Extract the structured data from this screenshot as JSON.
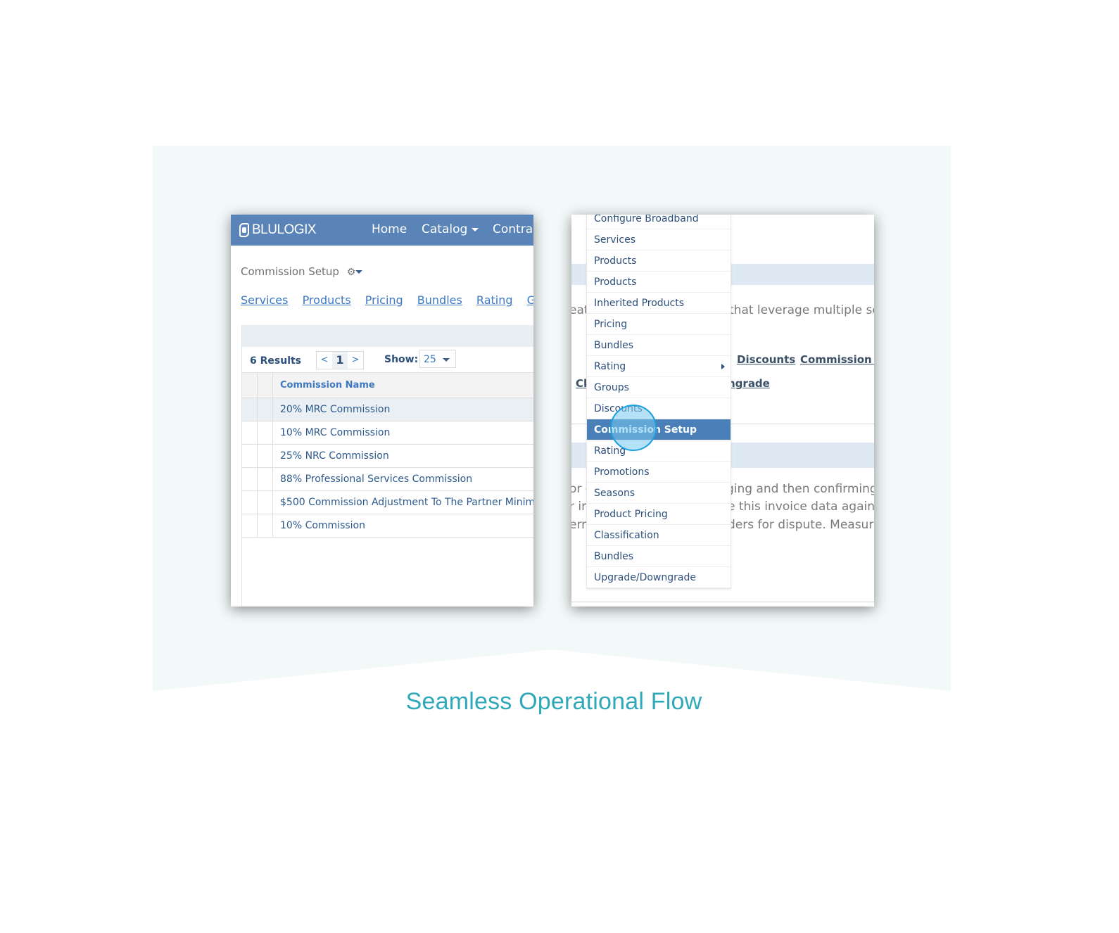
{
  "caption": "Seamless Operational Flow",
  "colors": {
    "brand_bar": "#5a84b8",
    "link": "#3d78c2",
    "menu_active": "#4a7fb8",
    "caption": "#2fa9b9",
    "cursor_ring": "#1aa0e0"
  },
  "left_panel": {
    "logo_text": "BLULOGIX",
    "logo_icon": "blulogix-logo-icon",
    "nav": [
      {
        "label": "Home"
      },
      {
        "label": "Catalog",
        "has_dropdown": true
      },
      {
        "label": "Contra"
      }
    ],
    "page_title": "Commission Setup",
    "gear_icon": "gear-icon",
    "subnav": [
      {
        "label": "Services"
      },
      {
        "label": "Products"
      },
      {
        "label": "Pricing"
      },
      {
        "label": "Bundles"
      },
      {
        "label": "Rating"
      },
      {
        "label": "Grou"
      }
    ],
    "results": "6 Results",
    "pager": {
      "prev": "<",
      "current": "1",
      "next": ">"
    },
    "show_label": "Show:",
    "show_value": "25",
    "table": {
      "column": "Commission Name",
      "rows": [
        "20% MRC Commission",
        "10% MRC Commission",
        "25% NRC Commission",
        "88% Professional Services Commission",
        "$500 Commission Adjustment To The Partner Minim",
        "10% Commission"
      ],
      "selected_row": 0
    }
  },
  "right_panel": {
    "background_text": {
      "line1_left": "eat",
      "line1_right": "that leverage multiple se",
      "links_row1": [
        "Discounts",
        "Commission Se"
      ],
      "links_row2_left": "Cl",
      "links_row2_right": "ngrade",
      "para": [
        {
          "left": "or c",
          "right": "ging and then confirming"
        },
        {
          "left": "r ir",
          "right": "e this invoice data agains"
        },
        {
          "left": "err",
          "right": "ders for dispute. Measurir"
        }
      ]
    },
    "menu": [
      {
        "label": "Configure Broadband"
      },
      {
        "label": "Services"
      },
      {
        "label": "Products"
      },
      {
        "label": "Products"
      },
      {
        "label": "Inherited Products"
      },
      {
        "label": "Pricing"
      },
      {
        "label": "Bundles"
      },
      {
        "label": "Rating",
        "has_submenu": true
      },
      {
        "label": "Groups"
      },
      {
        "label": "Discounts"
      },
      {
        "label": "Commission Setup",
        "active": true
      },
      {
        "label": "Rating"
      },
      {
        "label": "Promotions"
      },
      {
        "label": "Seasons"
      },
      {
        "label": "Product Pricing"
      },
      {
        "label": "Classification"
      },
      {
        "label": "Bundles"
      },
      {
        "label": "Upgrade/Downgrade"
      }
    ]
  }
}
